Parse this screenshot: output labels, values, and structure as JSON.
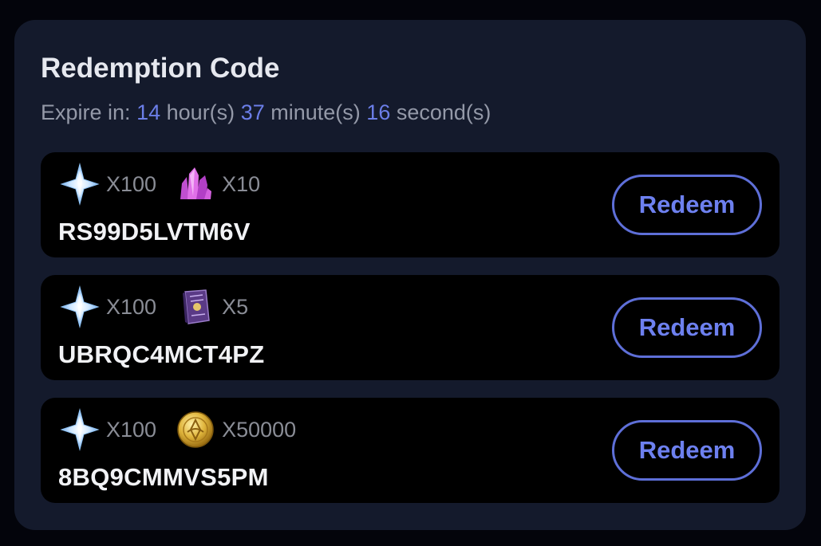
{
  "header": {
    "title": "Redemption Code",
    "expire": {
      "prefix": "Expire in:",
      "hours": "14",
      "hours_unit": "hour(s)",
      "minutes": "37",
      "minutes_unit": "minute(s)",
      "seconds": "16",
      "seconds_unit": "second(s)"
    }
  },
  "codes": [
    {
      "code": "RS99D5LVTM6V",
      "button_label": "Redeem",
      "rewards": [
        {
          "icon": "star-crystal-icon",
          "qty": "X100"
        },
        {
          "icon": "purple-crystal-icon",
          "qty": "X10"
        }
      ]
    },
    {
      "code": "UBRQC4MCT4PZ",
      "button_label": "Redeem",
      "rewards": [
        {
          "icon": "star-crystal-icon",
          "qty": "X100"
        },
        {
          "icon": "purple-book-icon",
          "qty": "X5"
        }
      ]
    },
    {
      "code": "8BQ9CMMVS5PM",
      "button_label": "Redeem",
      "rewards": [
        {
          "icon": "star-crystal-icon",
          "qty": "X100"
        },
        {
          "icon": "gold-coin-icon",
          "qty": "X50000"
        }
      ]
    }
  ],
  "colors": {
    "background": "#03040b",
    "panel": "#141a2c",
    "card": "#000000",
    "accent": "#6d80ef",
    "muted_text": "#9499a8"
  }
}
